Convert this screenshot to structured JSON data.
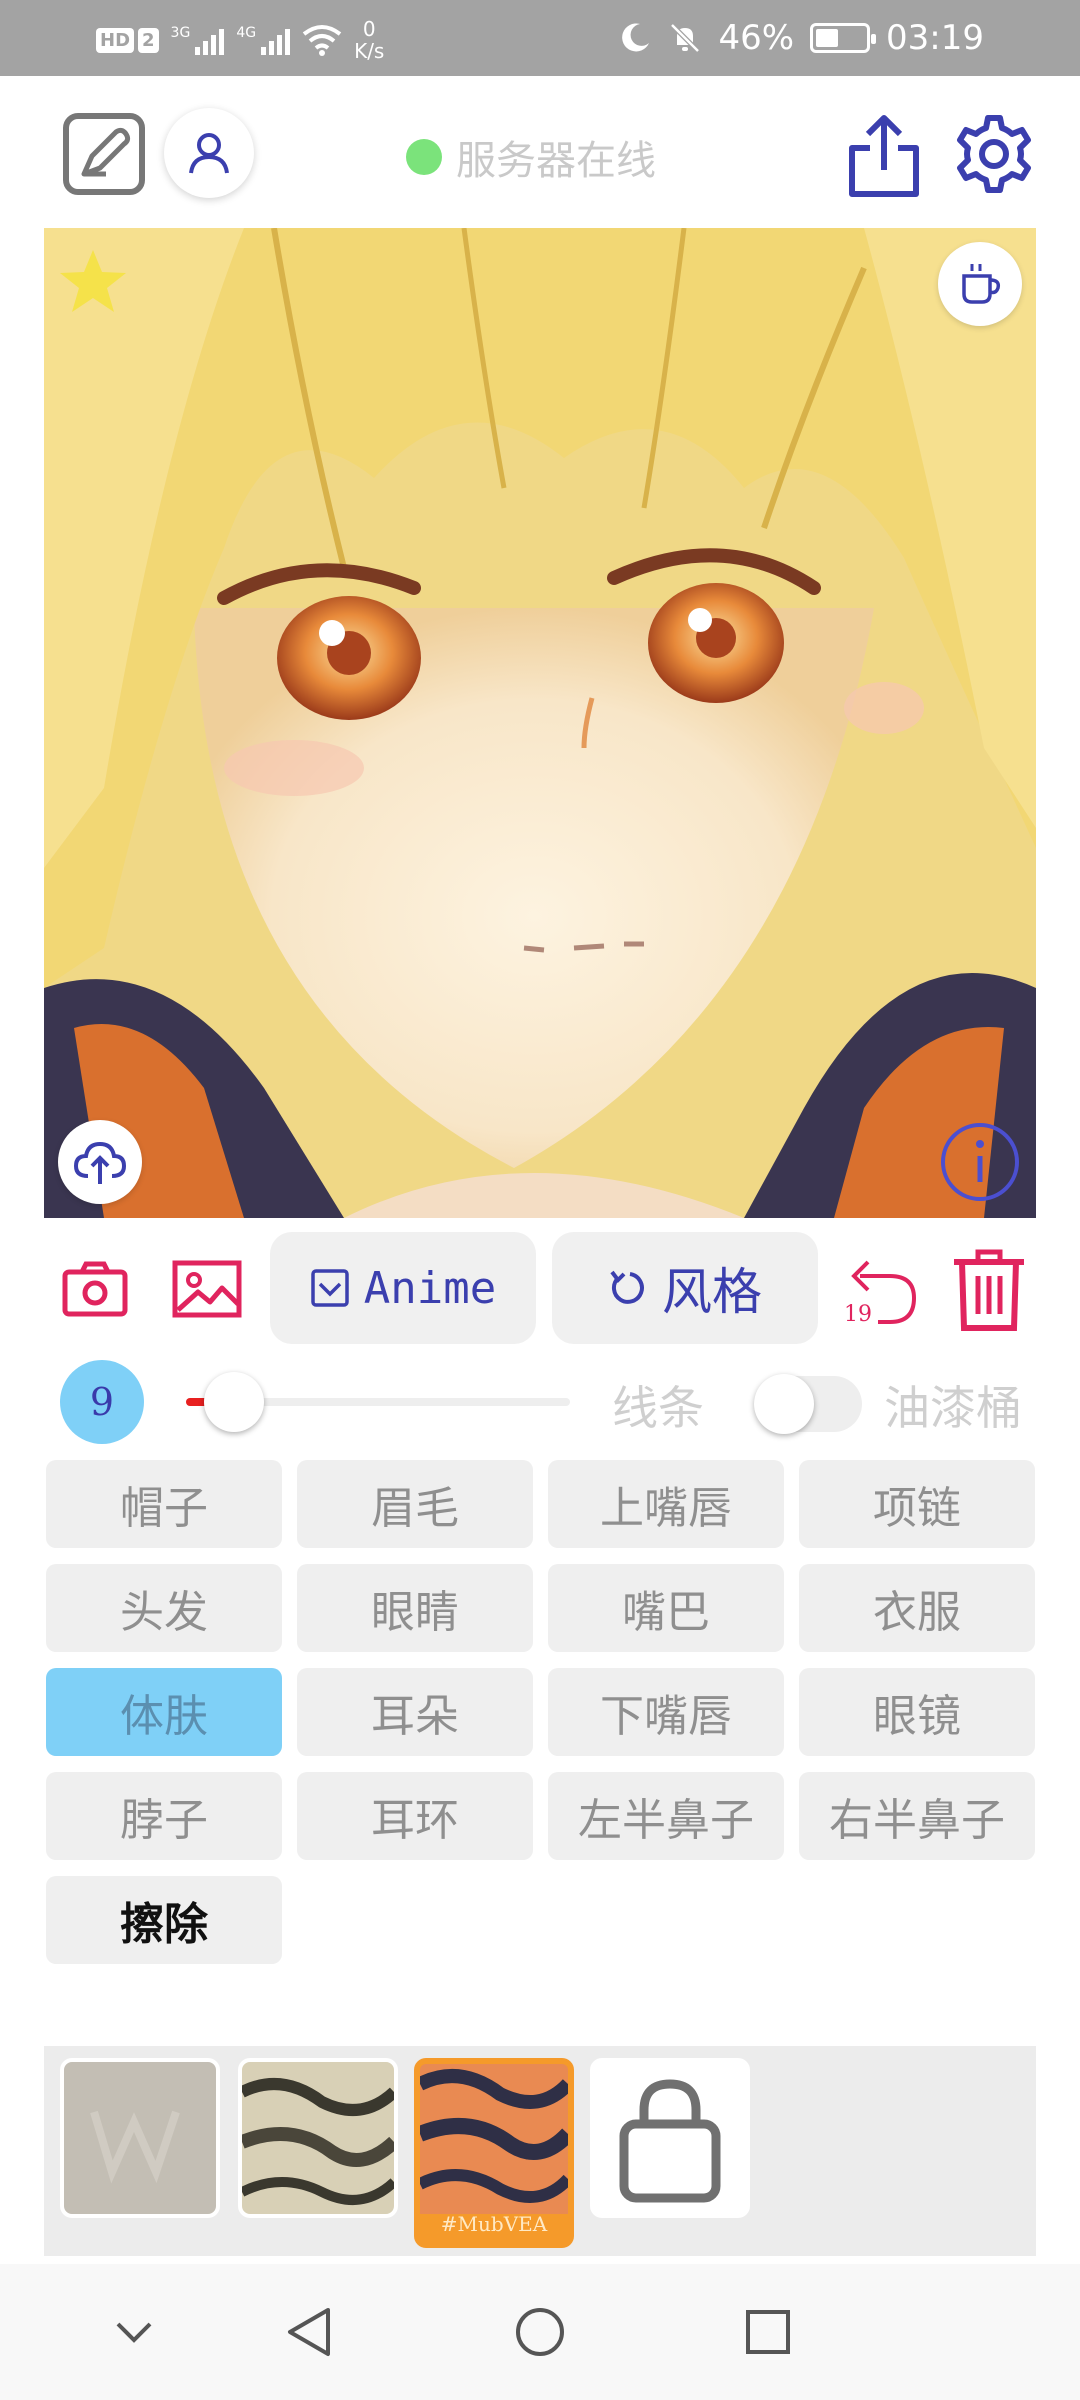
{
  "status_bar": {
    "hd_badge": "HD",
    "sim_badge": "2",
    "net_3g": "3G",
    "net_4g": "4G",
    "speed_value": "0",
    "speed_unit": "K/s",
    "battery": "46%",
    "battery_level": 0.46,
    "time": "03:19"
  },
  "header": {
    "server_status": "服务器在线",
    "server_status_color": "#7be37b"
  },
  "canvas": {
    "palette_primary": "#f2d774",
    "icons": [
      "star-icon",
      "coffee-icon",
      "upload-cloud-icon",
      "info-icon"
    ]
  },
  "actions": {
    "mode_label": "Anime",
    "style_label": "风格",
    "undo_count": "19",
    "accent_color": "#e0245e",
    "primary_color": "#3b3fae"
  },
  "brush": {
    "size": "9",
    "slider_value": 0.1,
    "lines_label": "线条",
    "bucket_label": "油漆桶",
    "bucket_enabled": false
  },
  "parts": [
    {
      "label": "帽子",
      "active": false
    },
    {
      "label": "眉毛",
      "active": false
    },
    {
      "label": "上嘴唇",
      "active": false
    },
    {
      "label": "项链",
      "active": false
    },
    {
      "label": "头发",
      "active": false
    },
    {
      "label": "眼睛",
      "active": false
    },
    {
      "label": "嘴巴",
      "active": false
    },
    {
      "label": "衣服",
      "active": false
    },
    {
      "label": "体肤",
      "active": true
    },
    {
      "label": "耳朵",
      "active": false
    },
    {
      "label": "下嘴唇",
      "active": false
    },
    {
      "label": "眼镜",
      "active": false
    },
    {
      "label": "脖子",
      "active": false
    },
    {
      "label": "耳环",
      "active": false
    },
    {
      "label": "左半鼻子",
      "active": false
    },
    {
      "label": "右半鼻子",
      "active": false
    },
    {
      "label": "擦除",
      "active": false
    }
  ],
  "styles": [
    {
      "caption": "",
      "selected": false
    },
    {
      "caption": "",
      "selected": false
    },
    {
      "caption": "#MubVEA",
      "selected": true
    },
    {
      "caption": "",
      "selected": false
    }
  ]
}
